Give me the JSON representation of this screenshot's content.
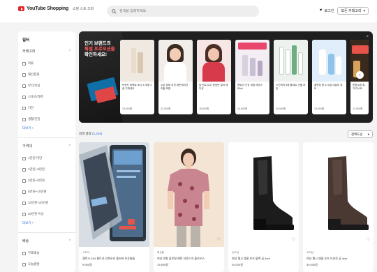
{
  "header": {
    "logo_text": "YouTube Shopping",
    "logo_sub": "쇼핑 스토 조회",
    "search_placeholder": "검색을 입력하세요",
    "login_label": "로그인",
    "dropdown_label": "모든 카테고리",
    "dropdown_icon": "chevron-down-icon"
  },
  "sidebar": {
    "title": "필터",
    "sections": [
      {
        "header": "카테고리",
        "items": [
          "의류",
          "패션잡화",
          "뷰티/미용",
          "스포츠/레저",
          "가전",
          "생활/건강"
        ],
        "more": "더보기 +"
      },
      {
        "header": "가격대",
        "items": [
          "1만원 미만",
          "1만원~3만원",
          "3만원~5만원",
          "5만원~10만원",
          "10만원~20만원",
          "20만원 이상"
        ],
        "more": "더보기 +"
      },
      {
        "header": "배송",
        "items": [
          "무료배송",
          "오늘출발"
        ]
      }
    ]
  },
  "banner": {
    "promo_line1": "인기 브랜드의",
    "promo_line2": "특별 프로모션을",
    "promo_line3": "확인하세요!",
    "cards": [
      {
        "text": "브랜드 퍼펙트 토너 & 세럼 2종 기획세트",
        "price": "29,900원"
      },
      {
        "text": "수분 광채 쿠션 파운데이션 리필 포함",
        "price": "32,000원"
      },
      {
        "text": "립 틴트 듀오 한정판 컬러 에디션",
        "price": "18,500원"
      },
      {
        "text": "봄맞이 신상 세럼 에센스 50ml",
        "price": "24,800원"
      },
      {
        "text": "스킨케어 5종 풀세트 선물 포장",
        "price": "45,900원"
      },
      {
        "text": "클렌징 폼 & 오일 데일리 세트",
        "price": "16,900원"
      },
      {
        "text": "한정수량 특가 미스트",
        "price": "12,900원"
      }
    ],
    "close_icon": "close-icon",
    "next_icon": "chevron-right-icon"
  },
  "results": {
    "label": "검색 결과",
    "count": "(1,234)",
    "sort_label": "정확도순"
  },
  "products": [
    {
      "store": "스토어",
      "title": "갤럭시 S24 울트라 강화유리 풀커버 보호필름",
      "price": "9,900원"
    },
    {
      "store": "패션몰",
      "title": "여성 반팔 플로럴 패턴 라운드넥 블라우스",
      "price": "19,800원"
    },
    {
      "store": "슈즈샵",
      "title": "여성 첼시 앵클 부츠 블랙 굽 4cm",
      "price": "39,000원"
    },
    {
      "store": "슈즈샵",
      "title": "여성 첼시 앵클 부츠 브라운 굽 4cm",
      "price": "39,000원"
    }
  ],
  "colors": {
    "brand_red": "#e4262b",
    "link_blue": "#1a60d6",
    "banner_bg": "#1f1f1f"
  }
}
